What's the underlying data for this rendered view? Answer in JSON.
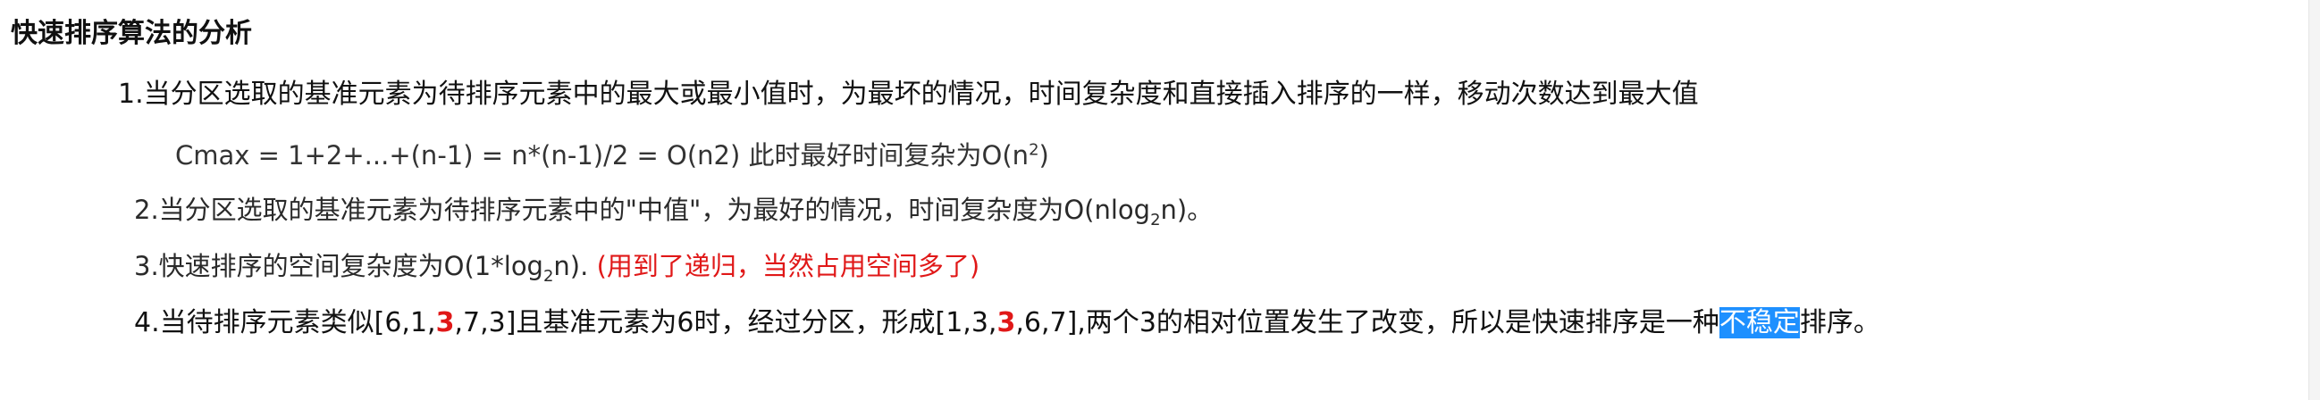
{
  "title": "快速排序算法的分析",
  "points": [
    {
      "text": "1.当分区选取的基准元素为待排序元素中的最大或最小值时，为最坏的情况，时间复杂度和直接插入排序的一样，移动次数达到最大值"
    },
    {
      "prefix": "Cmax = 1+2+...+(n-1) = n*(n-1)/2 = O(n2) 此时最好时间复杂为O(n",
      "sup": "2",
      "suffix": ")"
    },
    {
      "prefix": "2.当分区选取的基准元素为待排序元素中的\"中值\"，为最好的情况，时间复杂度为O(nlog",
      "sub": "2",
      "suffix": "n)。"
    },
    {
      "prefix": "3.快速排序的空间复杂度为O(1*log",
      "sub": "2",
      "suffix": "n). ",
      "note": "(用到了递归，当然占用空间多了)"
    },
    {
      "part1": "4.当待排序元素类似[6,1,",
      "red1": "3",
      "part2": ",7,3]且基准元素为6时，经过分区，形成[1,3,",
      "red2": "3",
      "part3": ",6,7],两个3的相对位置发生了改变，所以是快速排序是一种",
      "highlighted": "不稳定",
      "part4": "排序。"
    }
  ],
  "colors": {
    "text": "#111111",
    "emphasis_red": "#e01818",
    "selection_bg": "#1e90ff"
  }
}
